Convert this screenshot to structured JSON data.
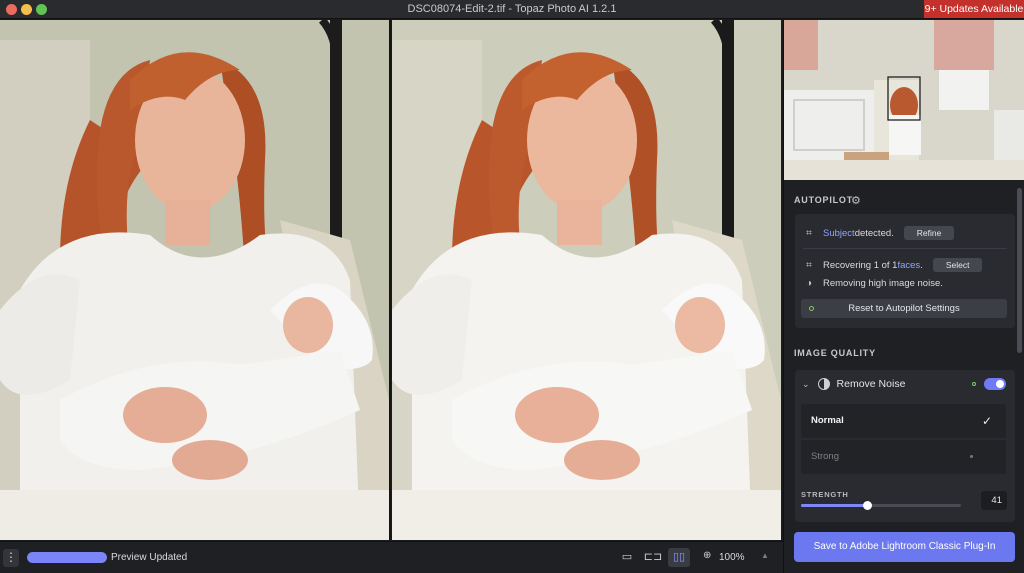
{
  "window": {
    "title": "DSC08074-Edit-2.tif - Topaz Photo AI 1.2.1",
    "updates_badge": "9+ Updates Available"
  },
  "autopilot": {
    "title": "AUTOPILOT",
    "subject_link": "Subject",
    "subject_rest": " detected.",
    "refine_label": "Refine",
    "faces_prefix": "Recovering 1 of 1 ",
    "faces_link": "faces",
    "faces_suffix": ".",
    "select_label": "Select",
    "noise_text": "Removing high image noise.",
    "reset_label": "Reset to Autopilot Settings"
  },
  "image_quality": {
    "title": "IMAGE QUALITY",
    "remove_noise": {
      "label": "Remove Noise",
      "enabled": true,
      "options": [
        "Normal",
        "Strong"
      ],
      "selected": "Normal",
      "strength_label": "STRENGTH",
      "strength_value": "41",
      "strength_fraction": 0.41
    }
  },
  "save_button": "Save to Adobe Lightroom Classic Plug-In",
  "bottom_bar": {
    "menu_glyph": "⋮",
    "progress_fraction": 1.0,
    "preview_status": "Preview Updated",
    "zoom": "100%",
    "view_modes": [
      "single",
      "split",
      "side-by-side"
    ],
    "active_view": "side-by-side"
  },
  "icons": {
    "subject": "subject-detect-icon",
    "face": "face-detect-icon",
    "noise": "noise-icon",
    "gear": "gear-icon",
    "zoom": "magnifier-icon"
  },
  "colors": {
    "accent": "#6b78ef",
    "updates_red": "#c4302b",
    "link_blue": "#8fa6ff"
  }
}
